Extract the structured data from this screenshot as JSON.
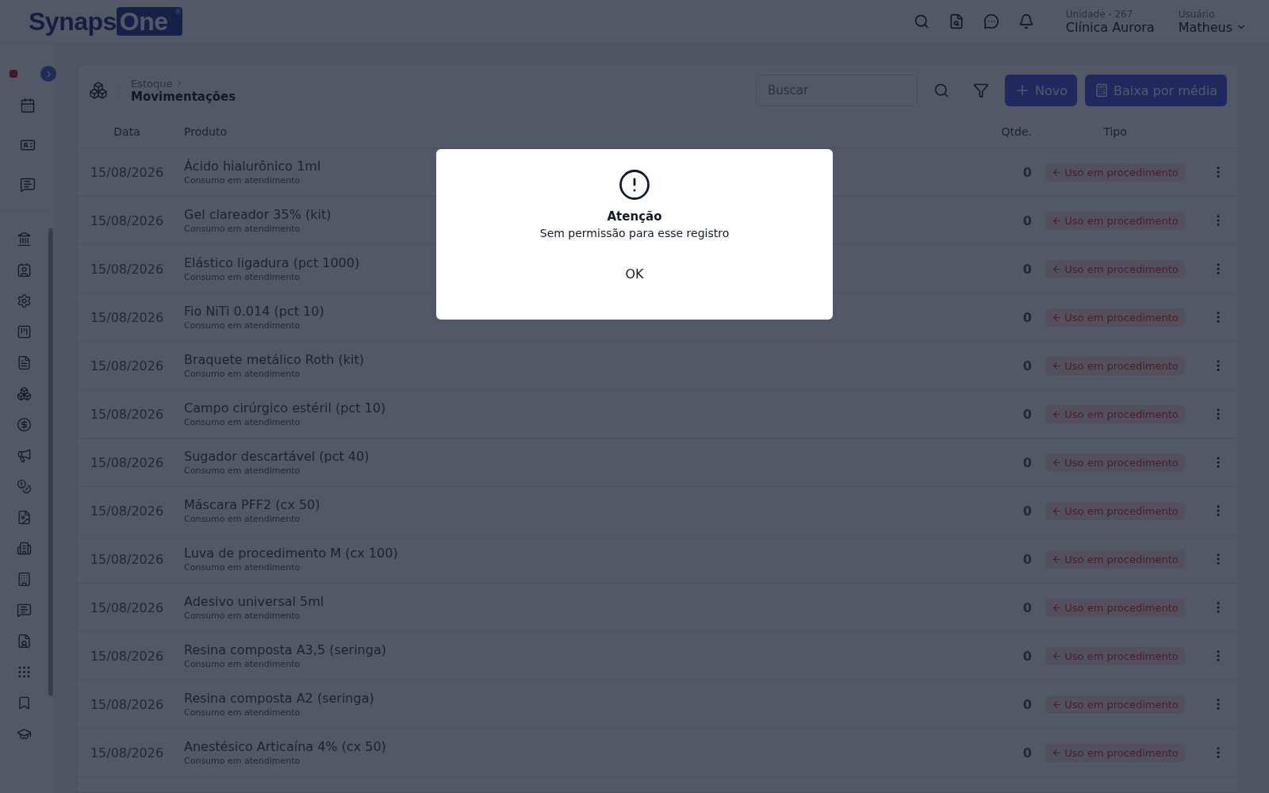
{
  "header": {
    "logo": {
      "word": "Synaps",
      "boxed": "One",
      "mark": "®"
    },
    "unit_label": "Unidade - 267",
    "unit_name": "Clínica Aurora",
    "user_label": "Usuário",
    "user_name": "Matheus"
  },
  "page": {
    "breadcrumb": "Estoque",
    "title": "Movimentações",
    "search": {
      "placeholder": "Buscar"
    },
    "buttons": [
      "Novo",
      "Baixa por média"
    ]
  },
  "table": {
    "columns": [
      "Data",
      "Produto",
      "Qtde.",
      "Tipo"
    ],
    "rows": [
      {
        "date": "15/08/2026",
        "product": "Ácido hialurônico 1ml",
        "note": "Consumo em atendimento",
        "qty": "0",
        "type": "Uso em procedimento"
      },
      {
        "date": "15/08/2026",
        "product": "Gel clareador 35% (kit)",
        "note": "Consumo em atendimento",
        "qty": "0",
        "type": "Uso em procedimento"
      },
      {
        "date": "15/08/2026",
        "product": "Elástico ligadura (pct 1000)",
        "note": "Consumo em atendimento",
        "qty": "0",
        "type": "Uso em procedimento"
      },
      {
        "date": "15/08/2026",
        "product": "Fio NiTi 0.014 (pct 10)",
        "note": "Consumo em atendimento",
        "qty": "0",
        "type": "Uso em procedimento"
      },
      {
        "date": "15/08/2026",
        "product": "Braquete metálico Roth (kit)",
        "note": "Consumo em atendimento",
        "qty": "0",
        "type": "Uso em procedimento"
      },
      {
        "date": "15/08/2026",
        "product": "Campo cirúrgico estéril (pct 10)",
        "note": "Consumo em atendimento",
        "qty": "0",
        "type": "Uso em procedimento"
      },
      {
        "date": "15/08/2026",
        "product": "Sugador descartável (pct 40)",
        "note": "Consumo em atendimento",
        "qty": "0",
        "type": "Uso em procedimento"
      },
      {
        "date": "15/08/2026",
        "product": "Máscara PFF2 (cx 50)",
        "note": "Consumo em atendimento",
        "qty": "0",
        "type": "Uso em procedimento"
      },
      {
        "date": "15/08/2026",
        "product": "Luva de procedimento M (cx 100)",
        "note": "Consumo em atendimento",
        "qty": "0",
        "type": "Uso em procedimento"
      },
      {
        "date": "15/08/2026",
        "product": "Adesivo universal 5ml",
        "note": "Consumo em atendimento",
        "qty": "0",
        "type": "Uso em procedimento"
      },
      {
        "date": "15/08/2026",
        "product": "Resina composta A3,5 (seringa)",
        "note": "Consumo em atendimento",
        "qty": "0",
        "type": "Uso em procedimento"
      },
      {
        "date": "15/08/2026",
        "product": "Resina composta A2 (seringa)",
        "note": "Consumo em atendimento",
        "qty": "0",
        "type": "Uso em procedimento"
      },
      {
        "date": "15/08/2026",
        "product": "Anestésico Articaína 4% (cx 50)",
        "note": "Consumo em atendimento",
        "qty": "0",
        "type": "Uso em procedimento"
      }
    ]
  },
  "dialog": {
    "title": "Atenção",
    "message": "Sem permissão para esse registro",
    "button": "OK"
  }
}
